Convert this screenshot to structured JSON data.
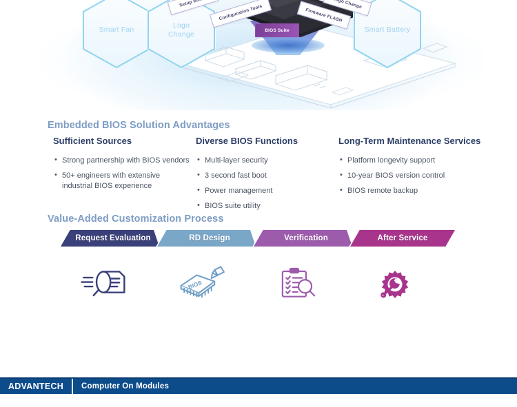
{
  "hero": {
    "hexagons": [
      {
        "label": "Smart Fan",
        "name": "hexagon-smart-fan"
      },
      {
        "label": "Logo\nChange",
        "name": "hexagon-logo-change"
      },
      {
        "label": "Smart Battery",
        "name": "hexagon-smart-battery"
      }
    ],
    "tags": [
      {
        "label": "Setup Editor",
        "name": "tag-setup-editor",
        "style": "outline"
      },
      {
        "label": "Configuration Tools",
        "name": "tag-configuration-tools",
        "style": "outline"
      },
      {
        "label": "BIOS Suite",
        "name": "tag-bios-suite",
        "style": "filled"
      },
      {
        "label": "Firmware FLASH",
        "name": "tag-firmware-flash",
        "style": "outline"
      },
      {
        "label": "Logo Change",
        "name": "tag-logo-change",
        "style": "outline"
      }
    ]
  },
  "advantages": {
    "heading": "Embedded BIOS Solution Advantages",
    "columns": [
      {
        "title": "Sufficient Sources",
        "items": [
          "Strong partnership with BIOS vendors",
          "50+ engineers with extensive industrial BIOS experience"
        ]
      },
      {
        "title": "Diverse BIOS Functions",
        "items": [
          "Multi-layer security",
          "3 second fast boot",
          "Power management",
          "BIOS suite utility"
        ]
      },
      {
        "title": "Long-Term Maintenance Services",
        "items": [
          "Platform longevity support",
          "10-year BIOS version control",
          "BIOS remote backup"
        ]
      }
    ]
  },
  "process": {
    "heading": "Value-Added Customization Process",
    "steps": [
      {
        "label": "Request Evaluation",
        "color": "#3a4079",
        "icon": "magnifier-document-icon",
        "icon_color": "#3a4079"
      },
      {
        "label": "RD Design",
        "color": "#7aa6c8",
        "icon": "bios-chip-pencil-icon",
        "icon_color": "#6f9ec5"
      },
      {
        "label": "Verification",
        "color": "#9d5bac",
        "icon": "clipboard-magnifier-icon",
        "icon_color": "#9d5bac"
      },
      {
        "label": "After Service",
        "color": "#a8348c",
        "icon": "gear-wrench-icon",
        "icon_color": "#a8348c"
      }
    ]
  },
  "footer": {
    "brand": "ADVANTECH",
    "title": "Computer On Modules"
  },
  "colors": {
    "section_heading": "#7e9dc4",
    "column_title": "#2c3e66",
    "body_text": "#4c5564",
    "footer_bg": "#0d4c8b",
    "hex_stroke": "#8fd4ef"
  }
}
